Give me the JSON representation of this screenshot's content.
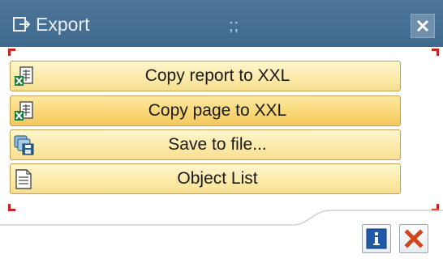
{
  "dialog": {
    "title": "Export",
    "grip": ";;",
    "title_icon": "export-icon",
    "close_icon": "close-icon"
  },
  "menu": {
    "items": [
      {
        "label": "Copy report to XXL",
        "icon": "excel-sheet-icon"
      },
      {
        "label": "Copy page to XXL",
        "icon": "excel-sheet-icon"
      },
      {
        "label": "Save to file...",
        "icon": "save-file-icon"
      },
      {
        "label": "Object List",
        "icon": "document-list-icon"
      }
    ]
  },
  "footer": {
    "info_icon": "info-icon",
    "cancel_icon": "cancel-icon"
  },
  "colors": {
    "titlebar": "#4d7599",
    "button_fill": "#fbe9a6",
    "button_active": "#f9d574",
    "accent_red": "#c0251f"
  }
}
